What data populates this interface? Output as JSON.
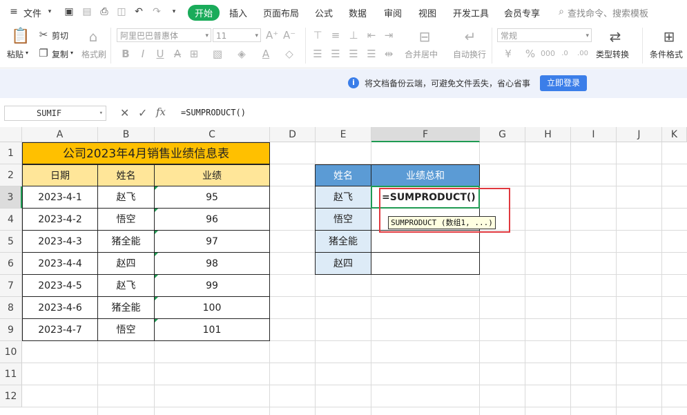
{
  "menubar": {
    "file_label": "文件",
    "tabs": [
      "开始",
      "插入",
      "页面布局",
      "公式",
      "数据",
      "审阅",
      "视图",
      "开发工具",
      "会员专享"
    ],
    "search_placeholder": "查找命令、搜索模板"
  },
  "ribbon": {
    "paste": "粘贴",
    "cut": "剪切",
    "copy": "复制",
    "format_painter": "格式刷",
    "font_name": "阿里巴巴普惠体",
    "font_size": "11",
    "merge_center": "合并居中",
    "wrap_text": "自动换行",
    "number_format": "常规",
    "type_convert": "类型转换",
    "conditional_format": "条件格式"
  },
  "notice": {
    "text": "将文档备份云端，可避免文件丢失，省心省事",
    "login_button": "立即登录"
  },
  "formula_bar": {
    "name_box": "SUMIF",
    "fx": "fx",
    "formula": "=SUMPRODUCT()"
  },
  "grid": {
    "columns": [
      "A",
      "B",
      "C",
      "D",
      "E",
      "F",
      "G",
      "H",
      "I",
      "J",
      "K"
    ],
    "rows": [
      "1",
      "2",
      "3",
      "4",
      "5",
      "6",
      "7",
      "8",
      "9",
      "10",
      "11",
      "12"
    ]
  },
  "table_main": {
    "title": "公司2023年4月销售业绩信息表",
    "headers": [
      "日期",
      "姓名",
      "业绩"
    ],
    "rows": [
      [
        "2023-4-1",
        "赵飞",
        "95"
      ],
      [
        "2023-4-2",
        "悟空",
        "96"
      ],
      [
        "2023-4-3",
        "猪全能",
        "97"
      ],
      [
        "2023-4-4",
        "赵四",
        "98"
      ],
      [
        "2023-4-5",
        "赵飞",
        "99"
      ],
      [
        "2023-4-6",
        "猪全能",
        "100"
      ],
      [
        "2023-4-7",
        "悟空",
        "101"
      ]
    ]
  },
  "table_summary": {
    "headers": [
      "姓名",
      "业绩总和"
    ],
    "names": [
      "赵飞",
      "悟空",
      "猪全能",
      "赵四"
    ],
    "active_cell_text": "=SUMPRODUCT()",
    "tooltip": "SUMPRODUCT (数组1, ...)"
  },
  "colors": {
    "accent_green": "#1aab5a",
    "title_fill": "#ffc000",
    "header_fill": "#ffe699",
    "summary_header_fill": "#5b9bd5",
    "summary_name_fill": "#ddebf7",
    "highlight_box": "#e0383e"
  }
}
